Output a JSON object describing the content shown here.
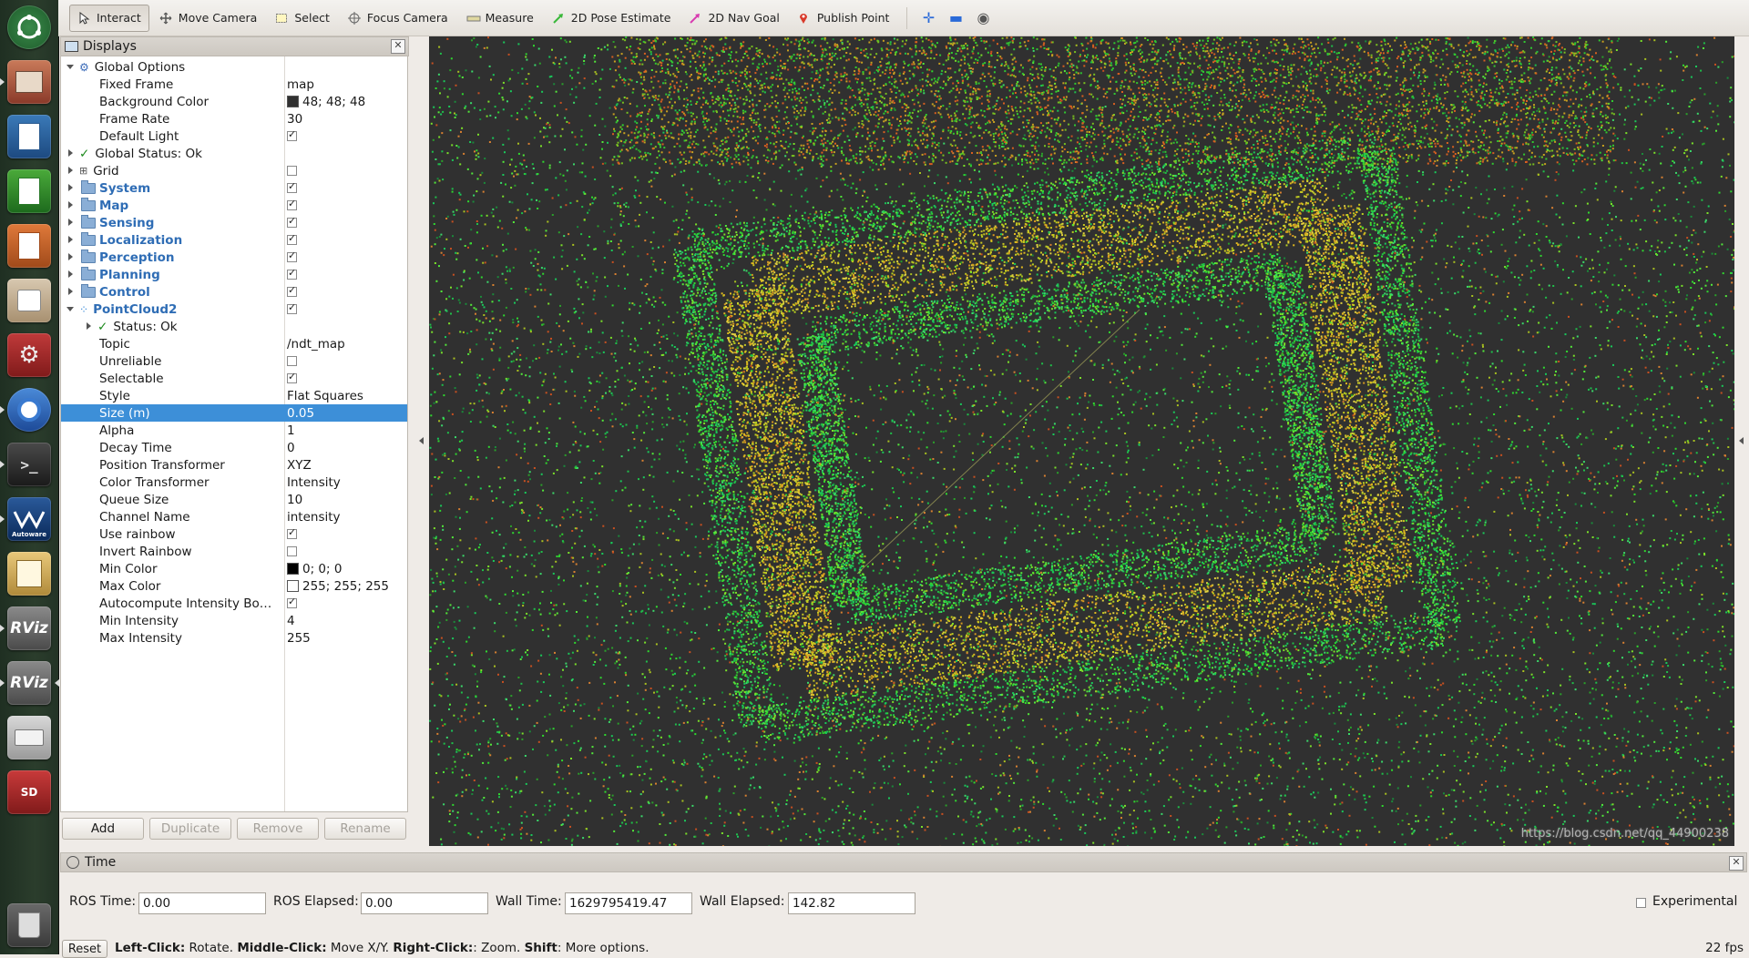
{
  "toolbar": {
    "tools": [
      {
        "label": "Interact",
        "icon": "cursor-icon"
      },
      {
        "label": "Move Camera",
        "icon": "move-camera-icon"
      },
      {
        "label": "Select",
        "icon": "select-box-icon"
      },
      {
        "label": "Focus Camera",
        "icon": "focus-icon"
      },
      {
        "label": "Measure",
        "icon": "ruler-icon"
      },
      {
        "label": "2D Pose Estimate",
        "icon": "green-arrow-icon"
      },
      {
        "label": "2D Nav Goal",
        "icon": "pink-arrow-icon"
      },
      {
        "label": "Publish Point",
        "icon": "map-pin-icon"
      }
    ]
  },
  "displays": {
    "title": "Displays",
    "rows": [
      {
        "name": "Global Options",
        "value": ""
      },
      {
        "name": "Fixed Frame",
        "value": "map"
      },
      {
        "name": "Background Color",
        "value": "48; 48; 48"
      },
      {
        "name": "Frame Rate",
        "value": "30"
      },
      {
        "name": "Default Light",
        "value": ""
      },
      {
        "name": "Global Status: Ok",
        "value": ""
      },
      {
        "name": "Grid",
        "value": ""
      },
      {
        "name": "System",
        "value": ""
      },
      {
        "name": "Map",
        "value": ""
      },
      {
        "name": "Sensing",
        "value": ""
      },
      {
        "name": "Localization",
        "value": ""
      },
      {
        "name": "Perception",
        "value": ""
      },
      {
        "name": "Planning",
        "value": ""
      },
      {
        "name": "Control",
        "value": ""
      },
      {
        "name": "PointCloud2",
        "value": ""
      },
      {
        "name": "Status: Ok",
        "value": ""
      },
      {
        "name": "Topic",
        "value": "/ndt_map"
      },
      {
        "name": "Unreliable",
        "value": ""
      },
      {
        "name": "Selectable",
        "value": ""
      },
      {
        "name": "Style",
        "value": "Flat Squares"
      },
      {
        "name": "Size (m)",
        "value": "0.05"
      },
      {
        "name": "Alpha",
        "value": "1"
      },
      {
        "name": "Decay Time",
        "value": "0"
      },
      {
        "name": "Position Transformer",
        "value": "XYZ"
      },
      {
        "name": "Color Transformer",
        "value": "Intensity"
      },
      {
        "name": "Queue Size",
        "value": "10"
      },
      {
        "name": "Channel Name",
        "value": "intensity"
      },
      {
        "name": "Use rainbow",
        "value": ""
      },
      {
        "name": "Invert Rainbow",
        "value": ""
      },
      {
        "name": "Min Color",
        "value": "0; 0; 0"
      },
      {
        "name": "Max Color",
        "value": "255; 255; 255"
      },
      {
        "name": "Autocompute Intensity Bo…",
        "value": ""
      },
      {
        "name": "Min Intensity",
        "value": "4"
      },
      {
        "name": "Max Intensity",
        "value": "255"
      }
    ],
    "buttons": {
      "add": "Add",
      "duplicate": "Duplicate",
      "remove": "Remove",
      "rename": "Rename"
    }
  },
  "time": {
    "title": "Time",
    "ros_time_label": "ROS Time:",
    "ros_time": "0.00",
    "ros_elapsed_label": "ROS Elapsed:",
    "ros_elapsed": "0.00",
    "wall_time_label": "Wall Time:",
    "wall_time": "1629795419.47",
    "wall_elapsed_label": "Wall Elapsed:",
    "wall_elapsed": "142.82",
    "experimental_label": "Experimental"
  },
  "status": {
    "reset": "Reset",
    "hint_1": "Left-Click:",
    "hint_1_desc": " Rotate. ",
    "hint_2": "Middle-Click:",
    "hint_2_desc": " Move X/Y. ",
    "hint_3": "Right-Click:",
    "hint_3_desc": ": Zoom. ",
    "hint_4": "Shift",
    "hint_4_desc": ": More options.",
    "fps": "22 fps",
    "watermark": "https://blog.csdn.net/qq_44900238"
  },
  "launcher": {
    "rviz1": "RViz",
    "rviz2": "RViz",
    "autoware": "Autoware",
    "sd": "SD"
  }
}
